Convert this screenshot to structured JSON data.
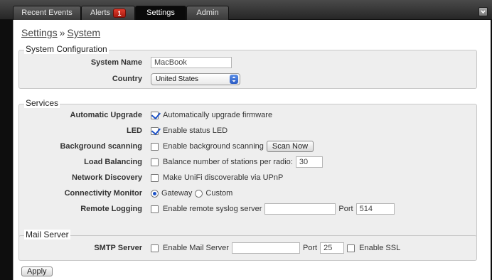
{
  "tabs": [
    {
      "label": "Recent Events"
    },
    {
      "label": "Alerts",
      "badge": "1"
    },
    {
      "label": "Settings"
    },
    {
      "label": "Admin"
    }
  ],
  "breadcrumb": {
    "parent": "Settings",
    "separator": "»",
    "current": "System"
  },
  "system_config": {
    "legend": "System Configuration",
    "system_name_label": "System Name",
    "system_name_value": "MacBook",
    "country_label": "Country",
    "country_value": "United States"
  },
  "services": {
    "legend": "Services",
    "auto_upgrade": {
      "label": "Automatic Upgrade",
      "text": "Automatically upgrade firmware",
      "checked": true
    },
    "led": {
      "label": "LED",
      "text": "Enable status LED",
      "checked": true
    },
    "bg_scan": {
      "label": "Background scanning",
      "text": "Enable background scanning",
      "button": "Scan Now",
      "checked": false
    },
    "load_balancing": {
      "label": "Load Balancing",
      "text": "Balance number of stations per radio:",
      "value": "30",
      "checked": false
    },
    "net_discovery": {
      "label": "Network Discovery",
      "text": "Make UniFi discoverable via UPnP",
      "checked": false
    },
    "conn_monitor": {
      "label": "Connectivity Monitor",
      "option_gateway": "Gateway",
      "option_custom": "Custom",
      "selected": "Gateway"
    },
    "remote_logging": {
      "label": "Remote Logging",
      "text": "Enable remote syslog server",
      "server_value": "",
      "port_label": "Port",
      "port_value": "514",
      "checked": false
    }
  },
  "mail_server": {
    "legend": "Mail Server",
    "smtp_label": "SMTP Server",
    "enable_text": "Enable Mail Server",
    "server_value": "",
    "port_label": "Port",
    "port_value": "25",
    "ssl_text": "Enable SSL",
    "enable_checked": false,
    "ssl_checked": false
  },
  "apply_label": "Apply",
  "colors": {
    "accent": "#1e53c8",
    "badge": "#d2281a",
    "panel_bg": "#eeeeee",
    "tabbar": "#2e2e2e"
  }
}
